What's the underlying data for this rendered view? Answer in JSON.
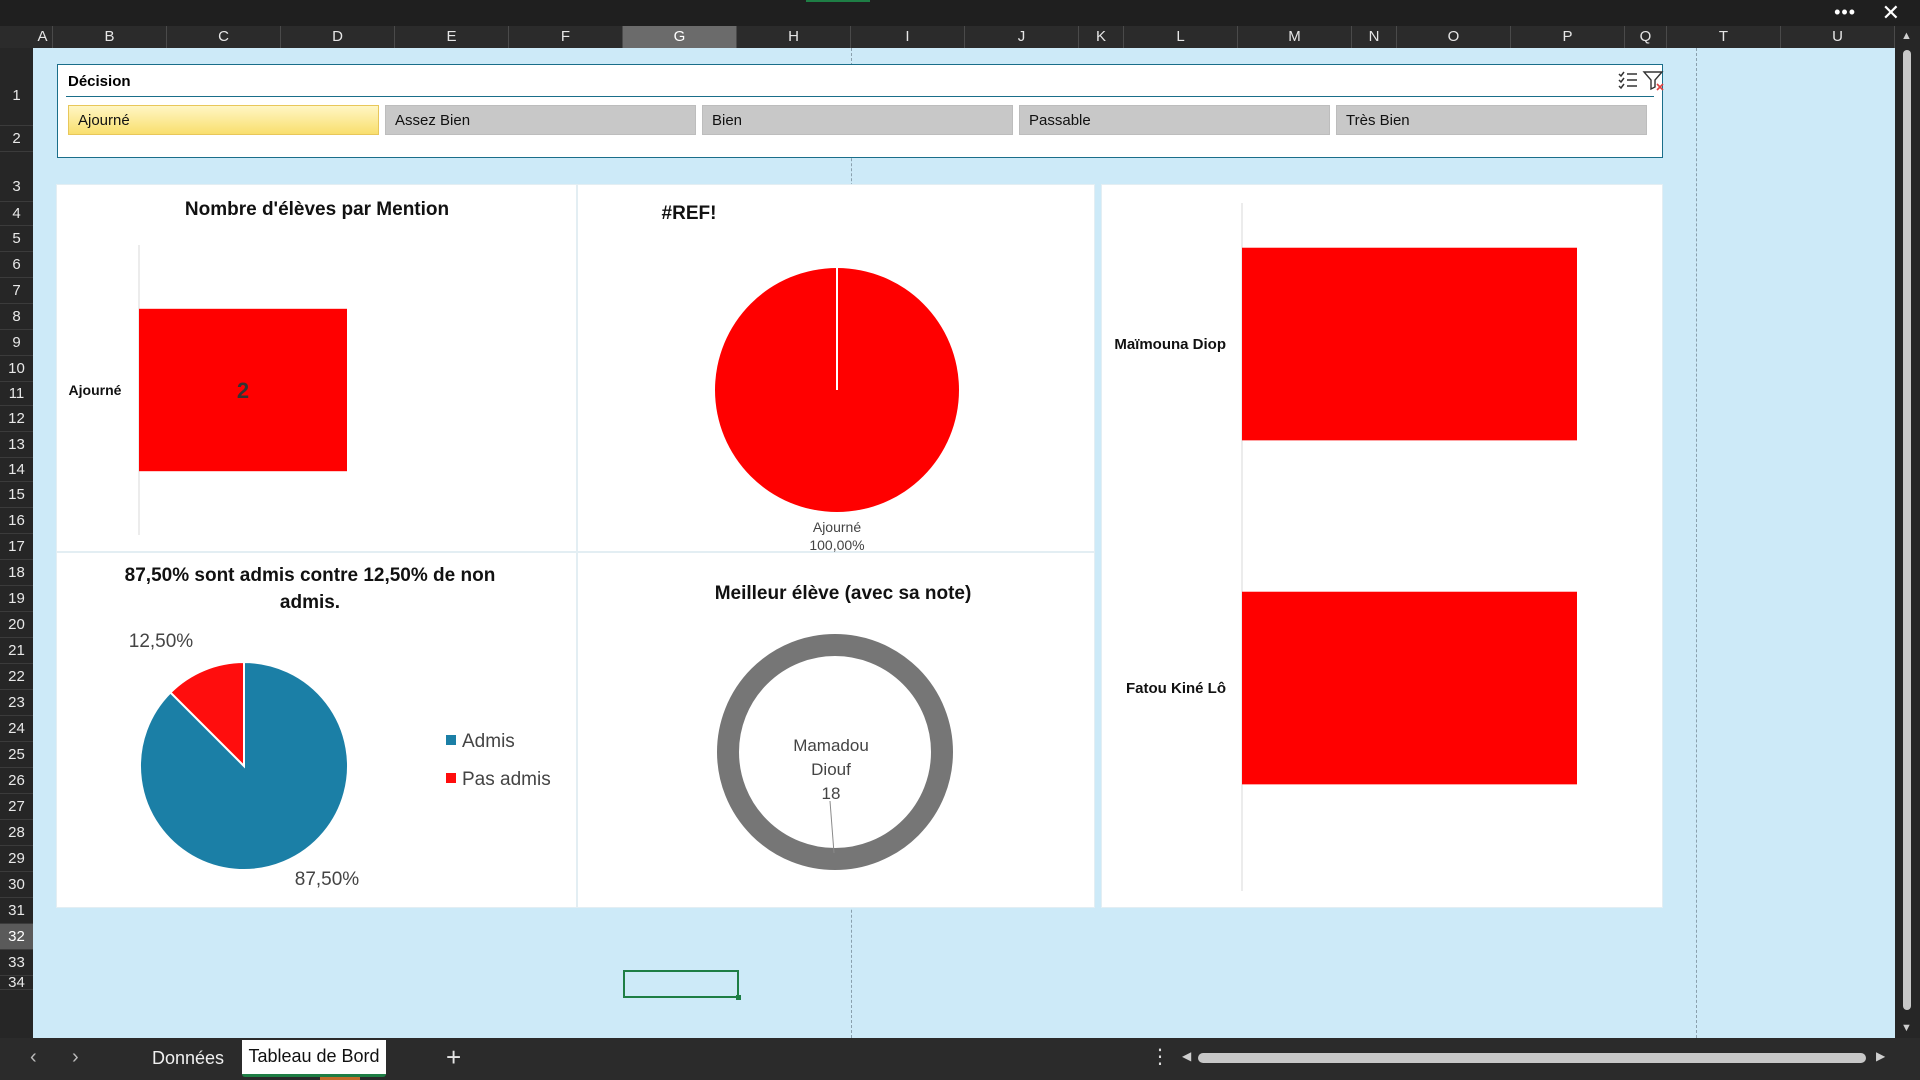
{
  "columns": [
    "A",
    "B",
    "C",
    "D",
    "E",
    "F",
    "G",
    "H",
    "I",
    "J",
    "K",
    "L",
    "M",
    "N",
    "O",
    "P",
    "Q",
    "T",
    "U"
  ],
  "selected_column": "G",
  "rows": [
    "1",
    "2",
    "3",
    "4",
    "5",
    "6",
    "7",
    "8",
    "9",
    "10",
    "11",
    "12",
    "13",
    "14",
    "15",
    "16",
    "17",
    "18",
    "19",
    "20",
    "21",
    "22",
    "23",
    "24",
    "25",
    "26",
    "27",
    "28",
    "29",
    "30",
    "31",
    "32",
    "33",
    "34"
  ],
  "selected_row": "32",
  "topbar": {
    "menu_label": "•••",
    "close_label": "✕"
  },
  "slicer": {
    "title": "Décision",
    "items": [
      {
        "label": "Ajourné",
        "active": true
      },
      {
        "label": "Assez Bien",
        "active": false
      },
      {
        "label": "Bien",
        "active": false
      },
      {
        "label": "Passable",
        "active": false
      },
      {
        "label": "Très Bien",
        "active": false
      }
    ],
    "icons": [
      "multi-select-icon",
      "clear-filter-icon"
    ]
  },
  "chart_data": [
    {
      "id": "mention",
      "type": "bar",
      "title": "Nombre d'élèves par Mention",
      "categories": [
        "Ajourné"
      ],
      "values": [
        2
      ],
      "orientation": "horizontal",
      "color": "#ff0000"
    },
    {
      "id": "ref",
      "type": "pie",
      "title": "#REF!",
      "labels": [
        "Ajourné"
      ],
      "values": [
        100
      ],
      "value_labels": [
        "100,00%"
      ],
      "colors": [
        "#ff0000"
      ]
    },
    {
      "id": "students",
      "type": "bar",
      "title": "",
      "orientation": "horizontal",
      "categories": [
        "Maïmouna Diop",
        "Fatou Kiné Lô"
      ],
      "values": [
        1,
        1
      ],
      "color": "#ff0000"
    },
    {
      "id": "admis",
      "type": "pie",
      "title": "87,50% sont admis contre 12,50% de non admis.",
      "title_lines": [
        "87,50% sont admis contre 12,50% de non",
        "admis."
      ],
      "labels": [
        "Admis",
        "Pas admis"
      ],
      "values": [
        87.5,
        12.5
      ],
      "value_labels": [
        "87,50%",
        "12,50%"
      ],
      "colors": [
        "#1b7fa6",
        "#ff0d0d"
      ],
      "legend": "right"
    },
    {
      "id": "best",
      "type": "pie",
      "title": "Meilleur élève (avec sa note)",
      "center_lines": [
        "Mamadou",
        "Diouf",
        "18"
      ],
      "labels": [
        "Mamadou Diouf"
      ],
      "values": [
        18
      ],
      "colors": [
        "#767676"
      ]
    }
  ],
  "sheet_tabs": [
    {
      "label": "Données",
      "active": false
    },
    {
      "label": "Tableau de Bord",
      "active": true
    }
  ],
  "add_tab_label": "+",
  "tab_more_label": "⋮"
}
